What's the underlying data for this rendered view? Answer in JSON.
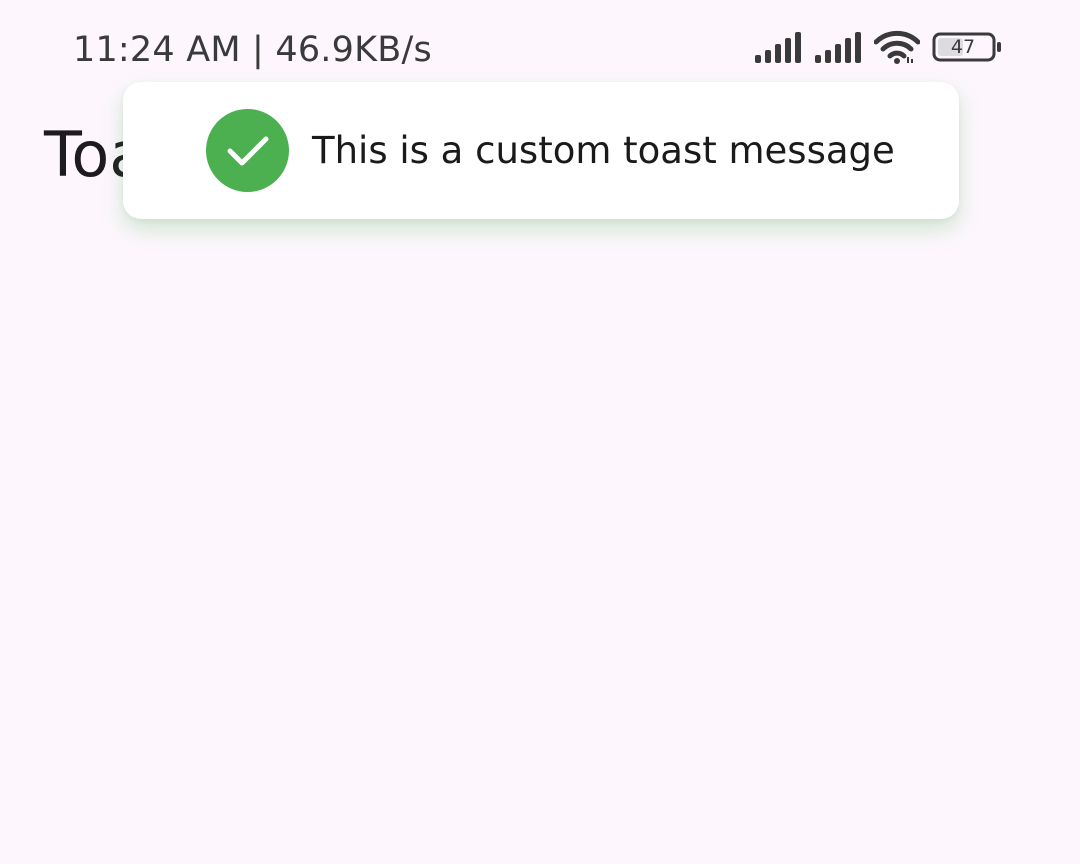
{
  "status_bar": {
    "time_speed": "11:24 AM | 46.9KB/s",
    "battery_level": "47",
    "icons": [
      "signal-icon",
      "signal-icon",
      "wifi-icon",
      "battery-icon"
    ]
  },
  "app": {
    "title": "Toast"
  },
  "toast": {
    "message": "This is a custom toast message",
    "icon": "check-circle-icon",
    "accent_color": "#4caf50"
  },
  "colors": {
    "background": "#fdf7fd",
    "toast_background": "#ffffff",
    "text": "#1a1a1a"
  }
}
